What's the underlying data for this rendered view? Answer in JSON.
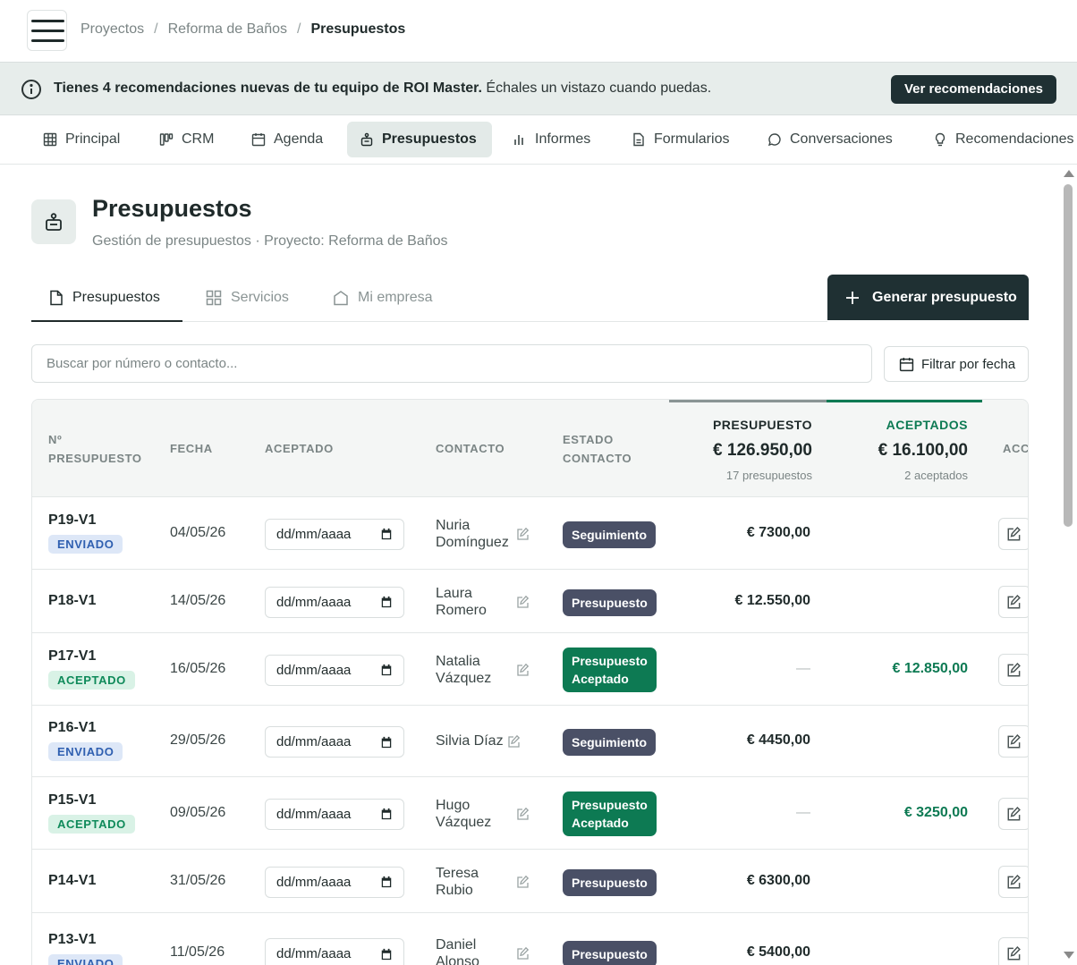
{
  "breadcrumb": [
    "Proyectos",
    "Reforma de Baños",
    "Presupuestos"
  ],
  "banner": {
    "bold_text": "Tienes 4 recomendaciones nuevas de tu equipo de ROI Master.",
    "text": " Échales un vistazo cuando puedas.",
    "button_label": "Ver recomendaciones"
  },
  "nav": [
    {
      "label": "Principal",
      "icon": "grid-icon"
    },
    {
      "label": "CRM",
      "icon": "kanban-icon"
    },
    {
      "label": "Agenda",
      "icon": "calendar-icon"
    },
    {
      "label": "Presupuestos",
      "icon": "bag-icon",
      "active": true
    },
    {
      "label": "Informes",
      "icon": "bar-chart-icon"
    },
    {
      "label": "Formularios",
      "icon": "document-icon"
    },
    {
      "label": "Conversaciones",
      "icon": "chat-icon"
    },
    {
      "label": "Recomendaciones",
      "icon": "lightbulb-icon"
    }
  ],
  "page": {
    "title": "Presupuestos",
    "subtitle": "Gestión de presupuestos · Proyecto: Reforma de Baños"
  },
  "subtabs": [
    {
      "label": "Presupuestos",
      "active": true
    },
    {
      "label": "Servicios"
    },
    {
      "label": "Mi empresa"
    }
  ],
  "generate_button": "Generar presupuesto",
  "search": {
    "placeholder": "Buscar por número o contacto...",
    "value": ""
  },
  "filter_button": "Filtrar por fecha",
  "table": {
    "headers": {
      "number_l1": "Nº",
      "number_l2": "PRESUPUESTO",
      "date": "FECHA",
      "accepted": "ACEPTADO",
      "contact": "CONTACTO",
      "status_l1": "ESTADO",
      "status_l2": "CONTACTO",
      "actions": "ACC"
    },
    "summary_budget": {
      "label": "PRESUPUESTO",
      "amount": "€ 126.950,00",
      "count": "17 presupuestos",
      "color": "#7b8585"
    },
    "summary_accepted": {
      "label": "ACEPTADOS",
      "amount": "€ 16.100,00",
      "count": "2 aceptados",
      "color": "#0d7a53"
    },
    "date_placeholder": "dd/mm/aaaa",
    "rows": [
      {
        "id": "P19-V1",
        "status": "ENVIADO",
        "date": "04/05/26",
        "contact_1": "Nuria",
        "contact_2": "Domínguez",
        "badge_1": "Seguimiento",
        "badge_2": "",
        "badge_color": "slate",
        "budget": "€ 7300,00",
        "accepted": ""
      },
      {
        "id": "P18-V1",
        "status": "",
        "date": "14/05/26",
        "contact_1": "Laura",
        "contact_2": "Romero",
        "badge_1": "Presupuesto",
        "badge_2": "",
        "badge_color": "slate",
        "budget": "€ 12.550,00",
        "accepted": ""
      },
      {
        "id": "P17-V1",
        "status": "ACEPTADO",
        "date": "16/05/26",
        "contact_1": "Natalia",
        "contact_2": "Vázquez",
        "badge_1": "Presupuesto",
        "badge_2": "Aceptado",
        "badge_color": "green",
        "budget": "—",
        "accepted": "€ 12.850,00"
      },
      {
        "id": "P16-V1",
        "status": "ENVIADO",
        "date": "29/05/26",
        "contact_1": "Silvia Díaz",
        "contact_2": "",
        "badge_1": "Seguimiento",
        "badge_2": "",
        "badge_color": "slate",
        "budget": "€ 4450,00",
        "accepted": ""
      },
      {
        "id": "P15-V1",
        "status": "ACEPTADO",
        "date": "09/05/26",
        "contact_1": "Hugo",
        "contact_2": "Vázquez",
        "badge_1": "Presupuesto",
        "badge_2": "Aceptado",
        "badge_color": "green",
        "budget": "—",
        "accepted": "€ 3250,00"
      },
      {
        "id": "P14-V1",
        "status": "",
        "date": "31/05/26",
        "contact_1": "Teresa",
        "contact_2": "Rubio",
        "badge_1": "Presupuesto",
        "badge_2": "",
        "badge_color": "slate",
        "budget": "€ 6300,00",
        "accepted": ""
      },
      {
        "id": "P13-V1",
        "status": "ENVIADO",
        "date": "11/05/26",
        "contact_1": "Daniel",
        "contact_2": "Alonso",
        "badge_1": "Presupuesto",
        "badge_2": "",
        "badge_color": "slate",
        "budget": "€ 5400,00",
        "accepted": ""
      }
    ]
  }
}
